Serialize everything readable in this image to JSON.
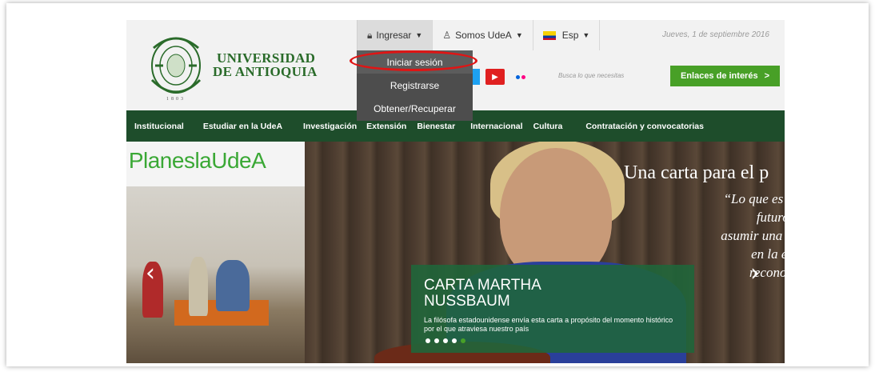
{
  "logo": {
    "line1": "UNIVERSIDAD",
    "line2": "DE ANTIOQUIA",
    "year": "1803"
  },
  "topbar": {
    "ingresar": "Ingresar",
    "somos": "Somos UdeA",
    "language": "Esp",
    "date": "Jueves, 1 de septiembre 2016"
  },
  "dropdown": {
    "items": [
      "Iniciar sesión",
      "Registrarse",
      "Obtener/Recuperar"
    ]
  },
  "search": {
    "placeholder": "Busca lo que necesitas"
  },
  "enlaces": "Enlaces de interés",
  "nav": [
    "Institucional",
    "Estudiar en la UdeA",
    "Investigación",
    "Extensión",
    "Bienestar",
    "Internacional",
    "Cultura",
    "Contratación y convocatorias"
  ],
  "hero": {
    "hashtag": "¡PlaneslaUdeA",
    "title": "Una carta para el p",
    "quote": [
      "“Lo que es e",
      "futuro,",
      "asumir una p",
      "en la es",
      "reconoc"
    ],
    "card_title_1": "CARTA MARTHA",
    "card_title_2": "NUSSBAUM",
    "card_text": "La filósofa estadounidense envía esta carta a propósito del momento histórico por el que atraviesa nuestro país"
  },
  "colors": {
    "green_nav": "#1e4d2b",
    "accent_green": "#48a027",
    "highlight": "#e01414"
  }
}
